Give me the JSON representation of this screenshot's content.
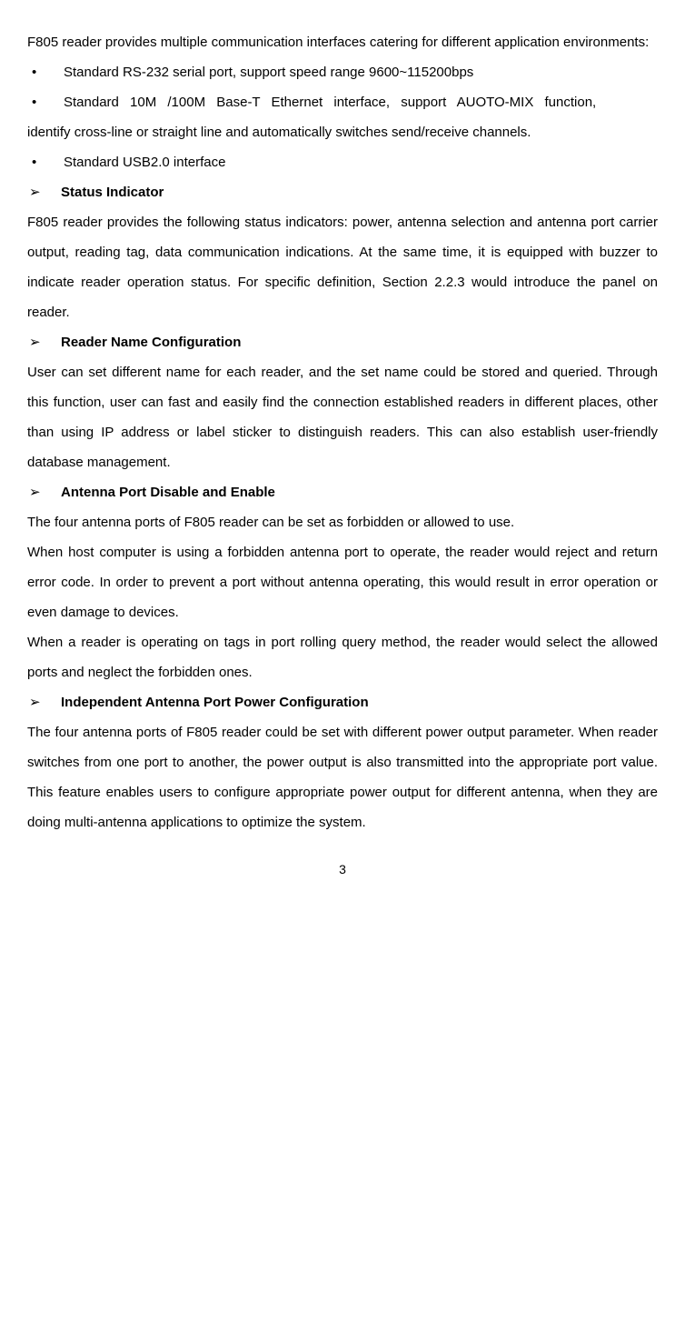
{
  "intro": "F805 reader provides multiple communication interfaces catering for different application environments:",
  "bullets": {
    "b1": "Standard RS-232 serial port, support speed range 9600~115200bps",
    "b2": "Standard 10M /100M Base-T Ethernet interface, support AUOTO-MIX function,",
    "b2_cont": "identify cross-line or straight line and automatically switches send/receive channels.",
    "b3": "Standard USB2.0 interface"
  },
  "sections": {
    "s1": {
      "title": "Status Indicator",
      "body": "F805 reader provides the following status indicators: power, antenna selection and antenna port carrier output, reading tag, data communication indications. At the same time, it is equipped with buzzer to indicate reader operation status. For specific definition, Section 2.2.3 would introduce the panel on reader."
    },
    "s2": {
      "title": "Reader Name Configuration",
      "body": "User can set different name for each reader, and the set name could be stored and queried. Through this function, user can fast and easily find the connection established readers in different places, other than using IP address or label sticker to distinguish readers. This can also establish user-friendly database management."
    },
    "s3": {
      "title": "Antenna Port Disable and Enable",
      "p1": "The four antenna ports of F805 reader can be set as forbidden or allowed to use.",
      "p2": "When host computer is using a forbidden antenna port to operate, the reader would reject and return error code. In order to prevent a port without antenna operating, this would result in error operation or even damage to devices.",
      "p3": "When a reader is operating on tags in port rolling query method, the reader would select the allowed ports and neglect the forbidden ones."
    },
    "s4": {
      "title": "Independent Antenna Port Power Configuration",
      "body": "The four antenna ports of F805 reader could be set with different power output parameter. When reader switches from one port to another, the power output is also transmitted into the appropriate port value. This feature enables users to configure appropriate power output for different antenna, when they are doing multi-antenna applications to optimize the system."
    }
  },
  "arrow": "➢",
  "bullet": "•",
  "page_number": "3"
}
